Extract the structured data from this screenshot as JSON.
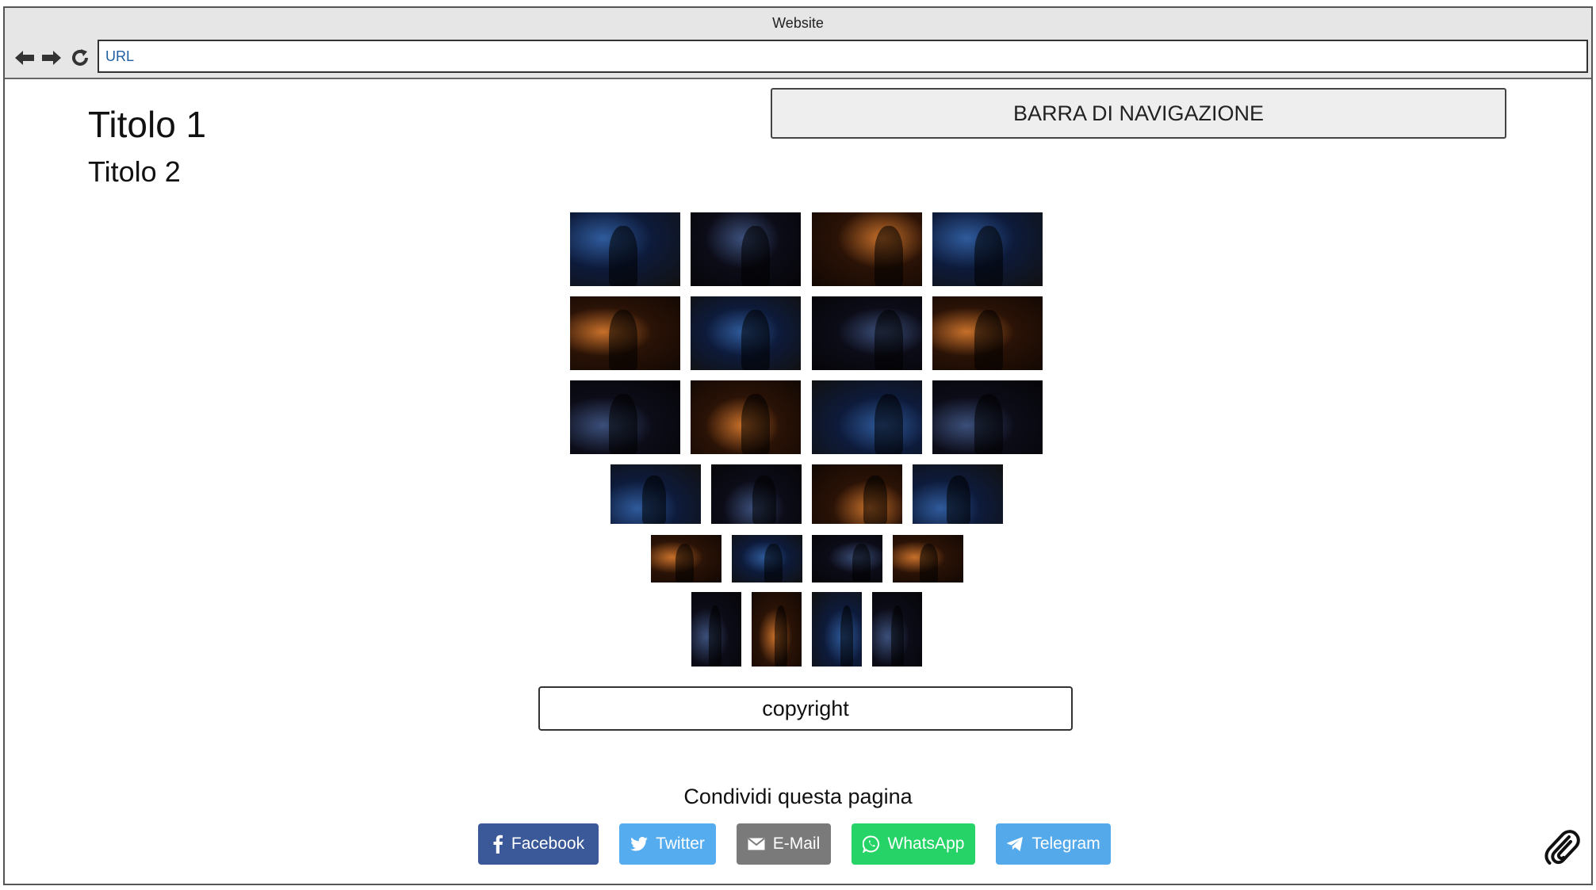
{
  "browser": {
    "title": "Website",
    "url_text": "URL",
    "buttons": [
      "back-arrow-icon",
      "forward-arrow-icon",
      "reload-icon"
    ]
  },
  "page": {
    "title1": "Titolo 1",
    "title2": "Titolo 2",
    "navbar_label": "BARRA DI NAVIGAZIONE",
    "copyright": "copyright"
  },
  "gallery": {
    "photo_count": 24,
    "description": "",
    "tones": [
      "dark",
      "blue-lit",
      "warm-lit",
      "grayscale"
    ]
  },
  "share": {
    "title": "Condividi questa pagina",
    "buttons": [
      {
        "label": "Facebook",
        "icon": "facebook-icon",
        "color": "#3b5998"
      },
      {
        "label": "Twitter",
        "icon": "twitter-bird-icon",
        "color": "#55acee"
      },
      {
        "label": "E-Mail",
        "icon": "mail-icon",
        "color": "#7a7a7a"
      },
      {
        "label": "WhatsApp",
        "icon": "whatsapp-icon",
        "color": "#25d366"
      },
      {
        "label": "Telegram",
        "icon": "telegram-icon",
        "color": "#54a9eb"
      }
    ]
  },
  "footer": {
    "attach_icon": "paperclip-icon"
  }
}
